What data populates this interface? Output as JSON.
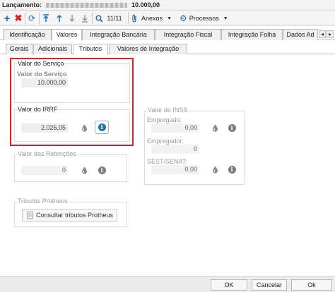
{
  "window": {
    "title_label": "Lançamento:",
    "title_value": "10.000,00"
  },
  "toolbar": {
    "record_counter": "11/11",
    "anexos_label": "Anexos",
    "processos_label": "Processos"
  },
  "main_tabs": [
    {
      "label": "Identificação",
      "active": false
    },
    {
      "label": "Valores",
      "active": true
    },
    {
      "label": "Integração Bancária",
      "active": false
    },
    {
      "label": "Integração Fiscal",
      "active": false
    },
    {
      "label": "Integração Folha",
      "active": false
    },
    {
      "label": "Dados Ad",
      "active": false
    }
  ],
  "sub_tabs": [
    {
      "label": "Gerais",
      "active": false
    },
    {
      "label": "Adicionais",
      "active": false
    },
    {
      "label": "Tributos",
      "active": true
    },
    {
      "label": "Valores de Integração",
      "active": false
    }
  ],
  "valor_servico": {
    "title": "Valor do Serviço",
    "field_label": "Valor do Serviço",
    "value": "10.000,00"
  },
  "valor_irrf": {
    "title": "Valor do IRRF",
    "value": "2.026,05"
  },
  "valor_retencoes": {
    "title": "Valor das Retenções",
    "value": "0"
  },
  "valor_inss": {
    "title": "Valor do INSS",
    "empregado_label": "Empregado:",
    "empregado_value": "0,00",
    "empregador_label": "Empregador:",
    "empregador_value": "0",
    "sest_senat_label": "SEST/SENAT:",
    "sest_senat_value": "0,00"
  },
  "tributos_protheus": {
    "title": "Tributos Protheus",
    "button_label": "Consultar tributos Protheus"
  },
  "footer": {
    "ok_label": "OK",
    "cancel_label": "Cancelar",
    "third_label": "Ok"
  },
  "colors": {
    "highlight": "#d9232a",
    "info_blue": "#1a79a8",
    "add_blue": "#1f6fb2",
    "delete_red": "#d22"
  }
}
